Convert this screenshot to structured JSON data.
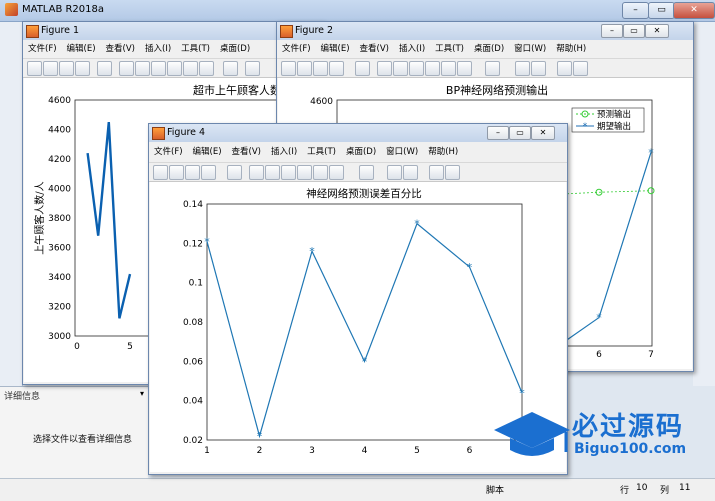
{
  "app": {
    "title": "MATLAB R2018a"
  },
  "main": {
    "detail_header": "详细信息",
    "detail_message": "选择文件以查看详细信息",
    "status_left": "脚本",
    "status_row_label": "行",
    "status_row": "10",
    "status_col_label": "列",
    "status_col": "11"
  },
  "figures": {
    "fig1": {
      "title": "Figure 1",
      "menu": [
        "文件(F)",
        "编辑(E)",
        "查看(V)",
        "插入(I)",
        "工具(T)",
        "桌面(D)"
      ],
      "plot_title": "超市上午顾客人数",
      "ylabel": "上午顾客人数/人",
      "yticks": [
        "4600",
        "4400",
        "4200",
        "4000",
        "3800",
        "3600",
        "3400",
        "3200",
        "3000"
      ],
      "xticks": [
        "0",
        "5"
      ]
    },
    "fig2": {
      "title": "Figure 2",
      "menu": [
        "文件(F)",
        "编辑(E)",
        "查看(V)",
        "插入(I)",
        "工具(T)",
        "桌面(D)",
        "窗口(W)",
        "帮助(H)"
      ],
      "plot_title": "BP神经网络预测输出",
      "ytick_top": "4600",
      "xticks": [
        "6",
        "7"
      ],
      "legend": [
        "预测输出",
        "期望输出"
      ]
    },
    "fig4": {
      "title": "Figure 4",
      "menu": [
        "文件(F)",
        "编辑(E)",
        "查看(V)",
        "插入(I)",
        "工具(T)",
        "桌面(D)",
        "窗口(W)",
        "帮助(H)"
      ],
      "plot_title": "神经网络预测误差百分比",
      "yticks": [
        "0.14",
        "0.12",
        "0.1",
        "0.08",
        "0.06",
        "0.04",
        "0.02"
      ],
      "xticks": [
        "1",
        "2",
        "3",
        "4",
        "5",
        "6",
        "7"
      ]
    }
  },
  "watermark": {
    "text": "必过源码",
    "sub": "Biguo100.com"
  },
  "colors": {
    "line": "#1f77b4",
    "pred": "#33cc33"
  },
  "chart_data": [
    {
      "type": "line",
      "title": "神经网络预测误差百分比",
      "x": [
        1,
        2,
        3,
        4,
        5,
        6,
        7
      ],
      "series": [
        {
          "values": [
            0.121,
            0.022,
            0.116,
            0.06,
            0.13,
            0.108,
            0.044
          ]
        }
      ],
      "xlim": [
        1,
        7
      ],
      "ylim": [
        0.02,
        0.14
      ]
    },
    {
      "type": "line",
      "title": "BP神经网络预测输出",
      "series": [
        {
          "name": "预测输出",
          "x": [
            6,
            7
          ],
          "values": [
            4000,
            4010
          ]
        },
        {
          "name": "期望输出",
          "x": [
            6,
            7
          ],
          "values": [
            3185,
            4260
          ]
        }
      ]
    },
    {
      "type": "line",
      "title": "超市上午顾客人数",
      "ylabel": "上午顾客人数/人",
      "x": [
        1,
        2,
        3,
        4,
        5
      ],
      "series": [
        {
          "values": [
            4240,
            3680,
            4450,
            3120,
            3420
          ]
        }
      ],
      "ylim": [
        3000,
        4600
      ]
    }
  ]
}
